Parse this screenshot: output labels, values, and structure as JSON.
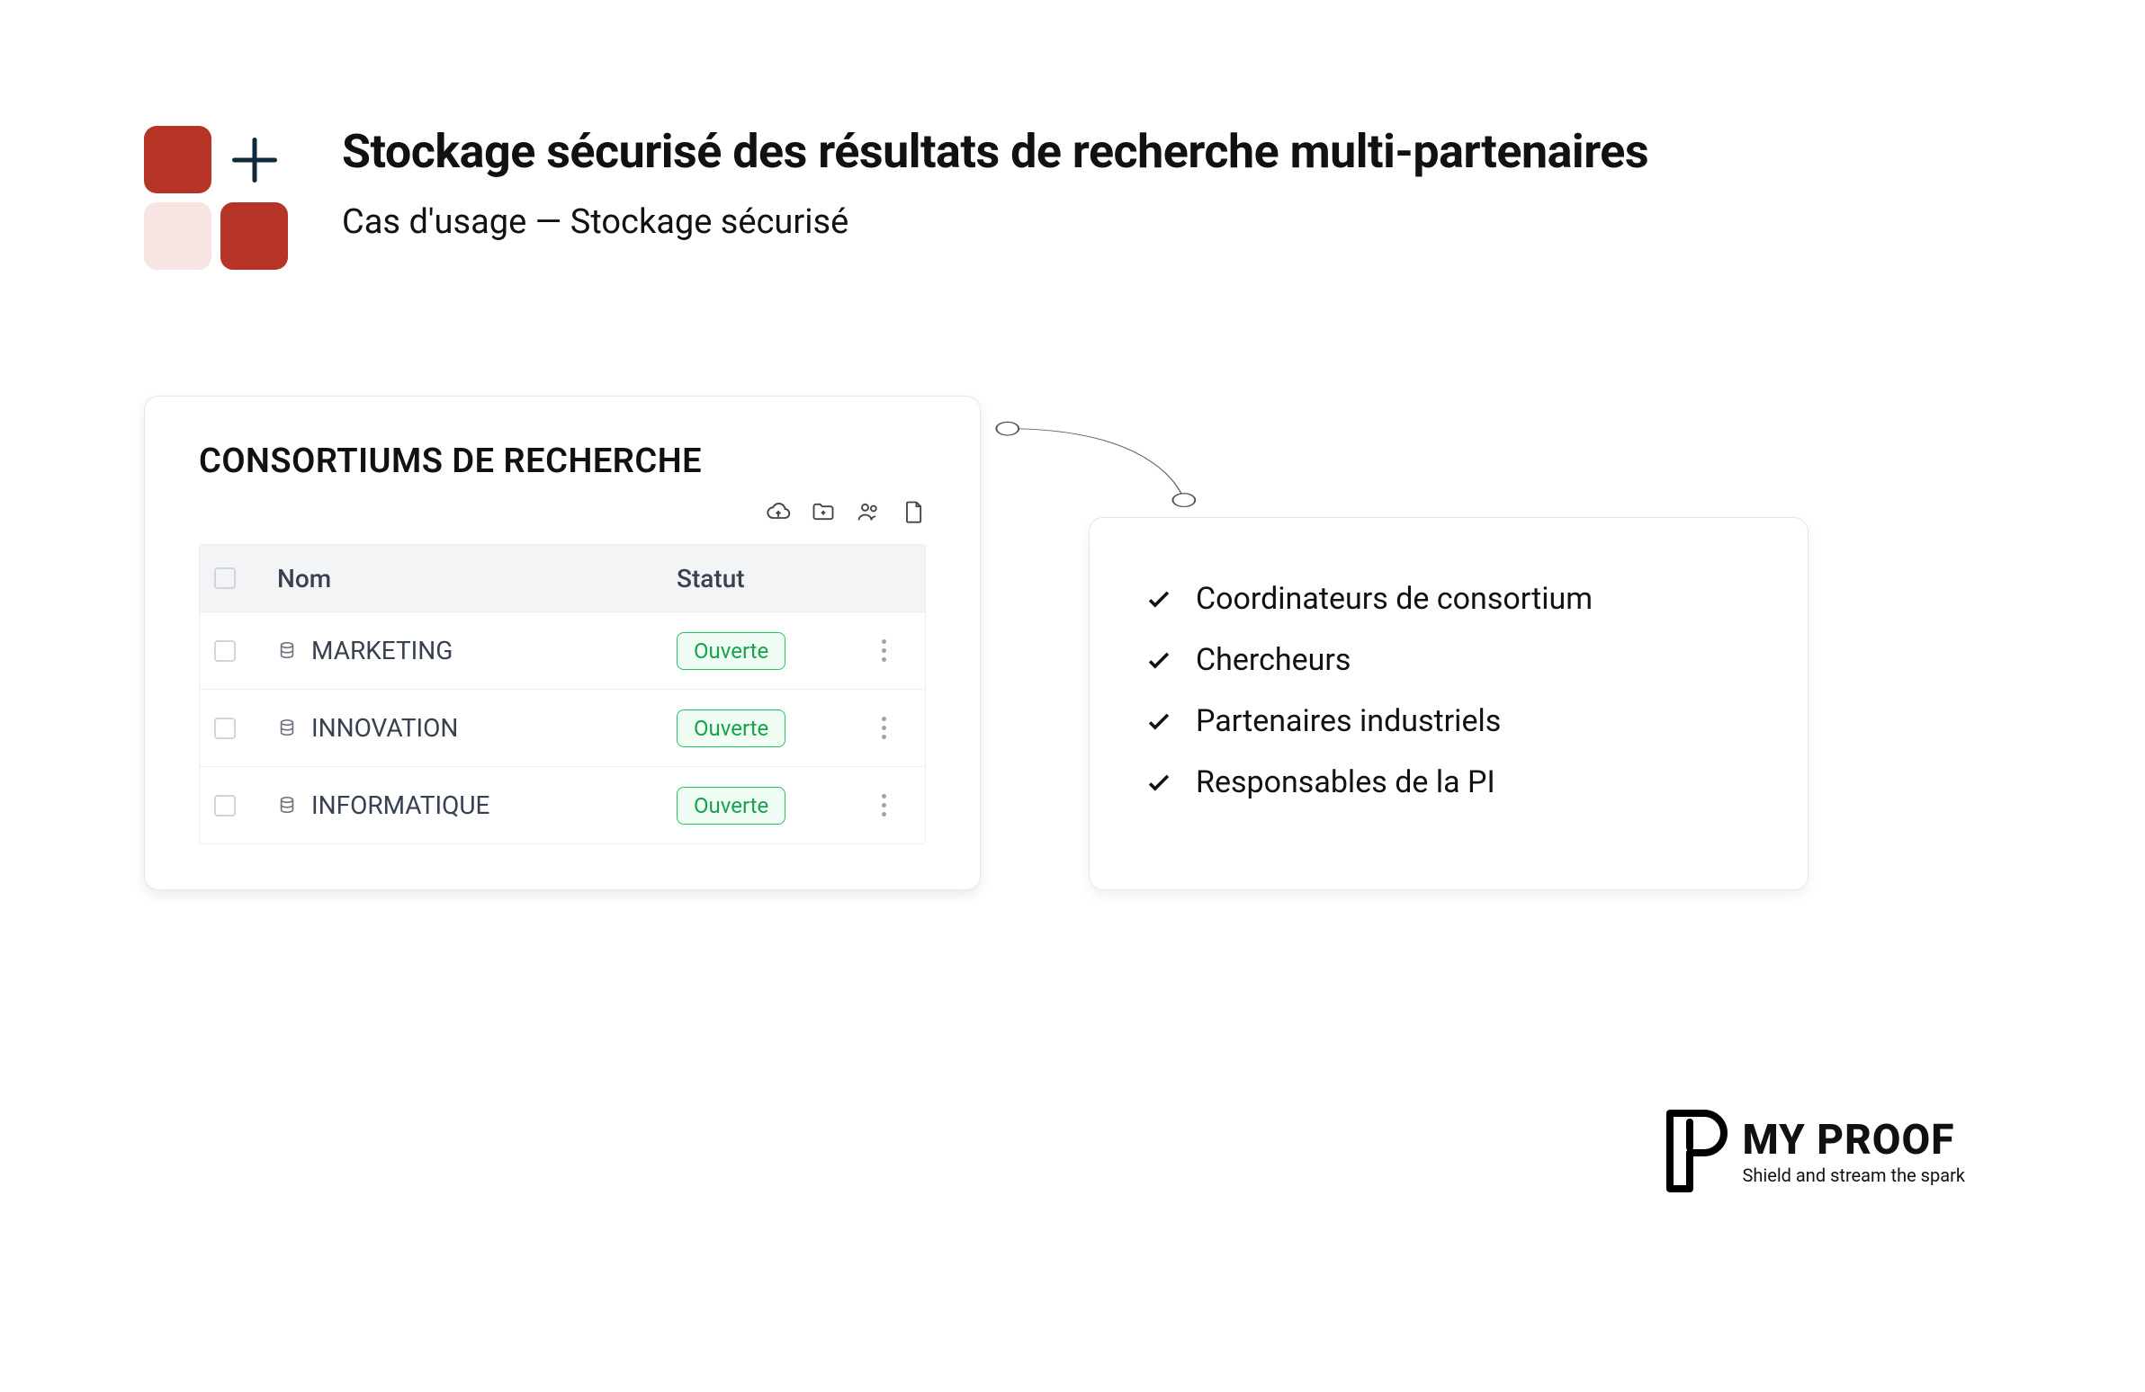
{
  "header": {
    "title": "Stockage sécurisé des résultats de recherche multi-partenaires",
    "subtitle": "Cas d'usage — Stockage sécurisé"
  },
  "card": {
    "title": "CONSORTIUMS DE RECHERCHE",
    "columns": {
      "name": "Nom",
      "status": "Statut"
    },
    "rows": [
      {
        "name": "MARKETING",
        "status": "Ouverte"
      },
      {
        "name": "INNOVATION",
        "status": "Ouverte"
      },
      {
        "name": "INFORMATIQUE",
        "status": "Ouverte"
      }
    ],
    "toolbar_icons": [
      "cloud-upload",
      "folder-plus",
      "users",
      "document"
    ]
  },
  "benefits": {
    "items": [
      "Coordinateurs de consortium",
      "Chercheurs",
      "Partenaires industriels",
      "Responsables de la PI"
    ]
  },
  "brand": {
    "name": "MY PROOF",
    "tagline": "Shield and stream the spark"
  }
}
